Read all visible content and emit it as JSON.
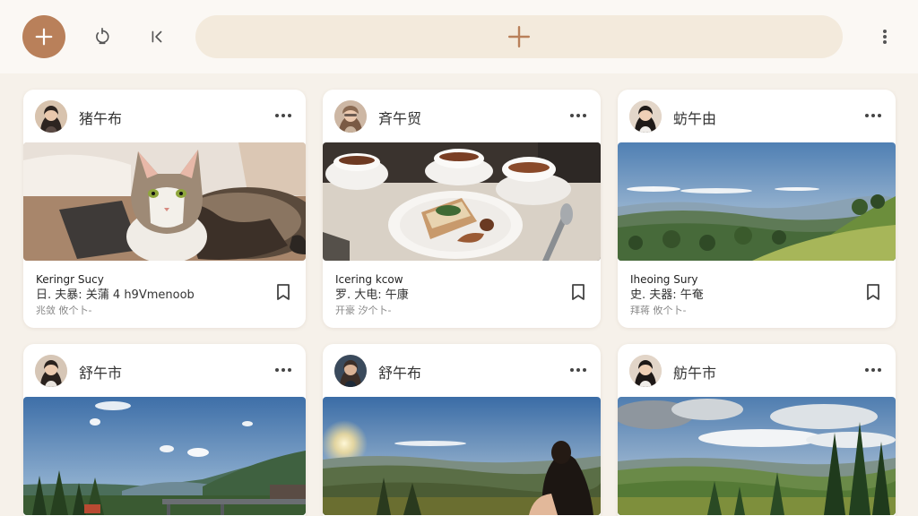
{
  "toolbar": {
    "fab_icon": "plus-icon",
    "refresh_icon": "refresh-icon",
    "back_icon": "skip-back-icon",
    "search_icon": "plus-icon",
    "menu_icon": "kebab-menu-icon",
    "accent_color": "#b9805a"
  },
  "cards": [
    {
      "author": "猪午布",
      "image": "cat",
      "caption": [
        "Keringr Sucy",
        "日. 夫暴: 关蒲    4 h9Vmenoob",
        "兆敛 攸个卜-"
      ]
    },
    {
      "author": "斉午贸",
      "image": "tea",
      "caption": [
        "Icering kcow",
        "罗. 大电: 午康",
        "开豪 汐个卜-"
      ]
    },
    {
      "author": "蚄午由",
      "image": "mountains",
      "caption": [
        "Iheoing Sury",
        "史. 夫器: 午奄",
        "拜蒋 攸个卜-"
      ]
    },
    {
      "author": "舒午市",
      "image": "sky",
      "caption": []
    },
    {
      "author": "舒午布",
      "image": "sunset",
      "caption": []
    },
    {
      "author": "舫午市",
      "image": "valley",
      "caption": []
    }
  ]
}
